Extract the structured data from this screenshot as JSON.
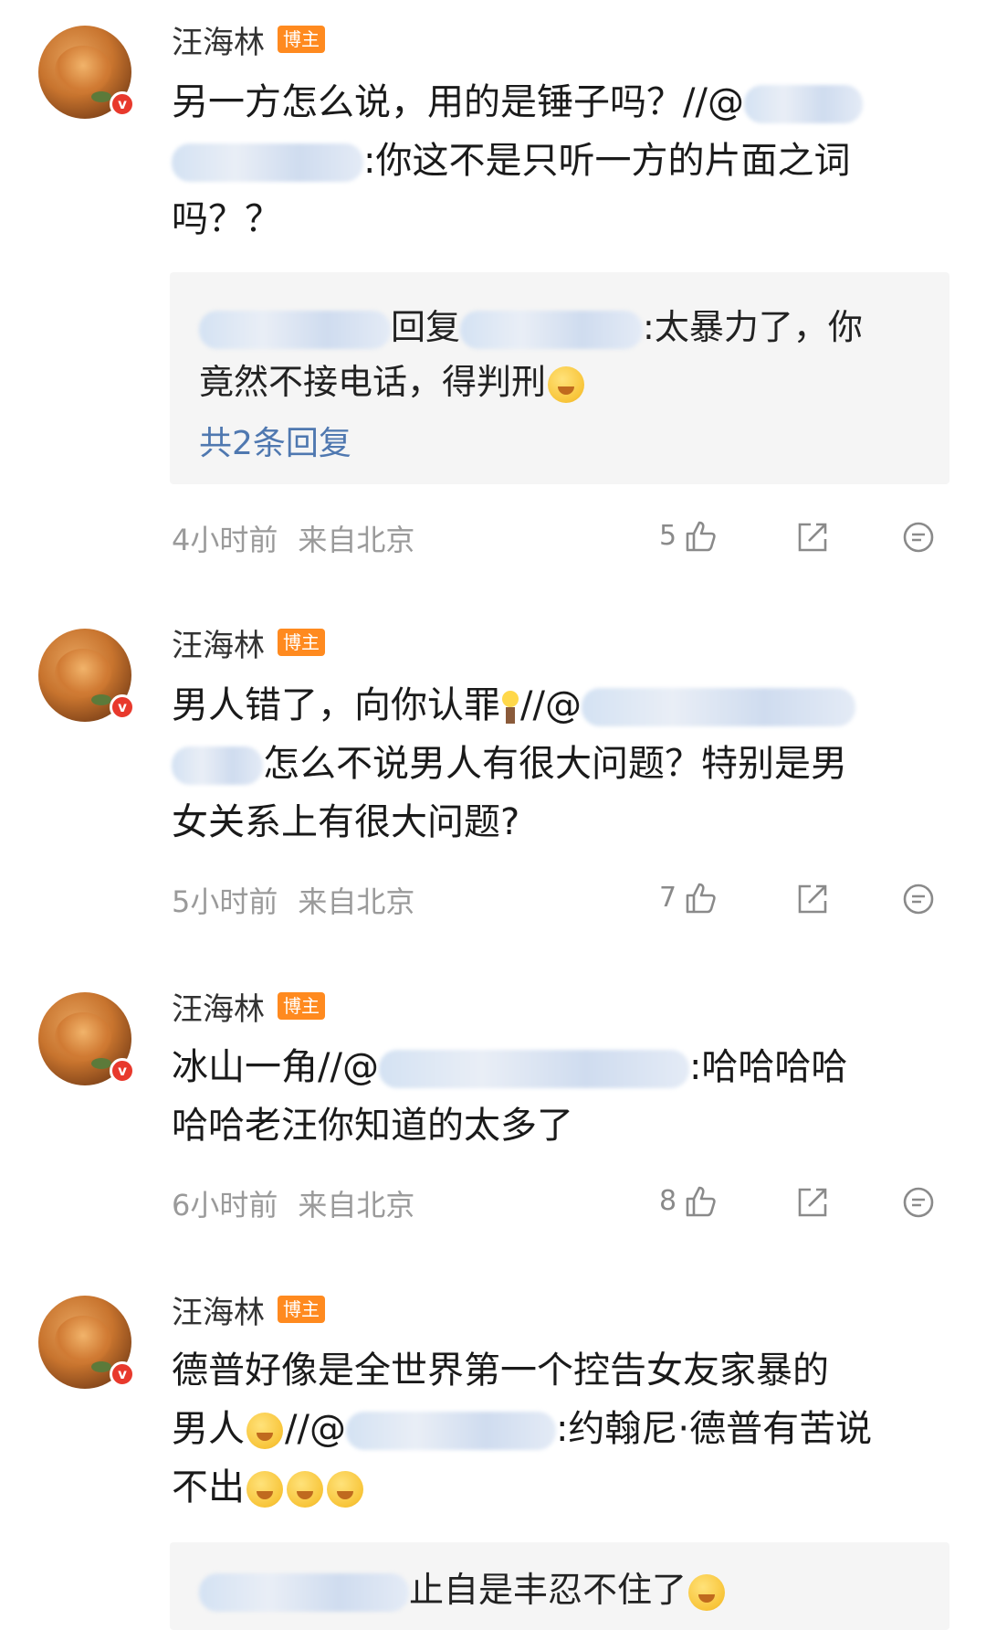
{
  "author": {
    "name": "汪海林",
    "tag": "博主",
    "badge": "v"
  },
  "comments": [
    {
      "text_a": "另一方怎么说，用的是锤子吗？//@",
      "text_b": ":你这不是只听一方的片面之词",
      "text_c": "吗？？",
      "reply": {
        "reply_word": "回复",
        "text_after": ":太暴力了，你",
        "line2": "竟然不接电话，得判刑",
        "count_label": "共2条回复"
      },
      "time": "4小时前",
      "location": "来自北京",
      "likes": "5"
    },
    {
      "text_a": "男人错了，向你认罪",
      "text_a2": "//@",
      "text_b": "怎么不说男人有很大问题？特别是男",
      "text_c": "女关系上有很大问题?",
      "time": "5小时前",
      "location": "来自北京",
      "likes": "7"
    },
    {
      "text_a": "冰山一角//@",
      "text_b": ":哈哈哈哈",
      "text_c": "哈哈老汪你知道的太多了",
      "time": "6小时前",
      "location": "来自北京",
      "likes": "8"
    },
    {
      "text_a": "德普好像是全世界第一个控告女友家暴的",
      "text_b1": "男人",
      "text_b2": "//@",
      "text_b3": ":约翰尼·德普有苦说",
      "text_c": "不出",
      "reply": {
        "text_after": "止自是丰忍不住了"
      }
    }
  ]
}
